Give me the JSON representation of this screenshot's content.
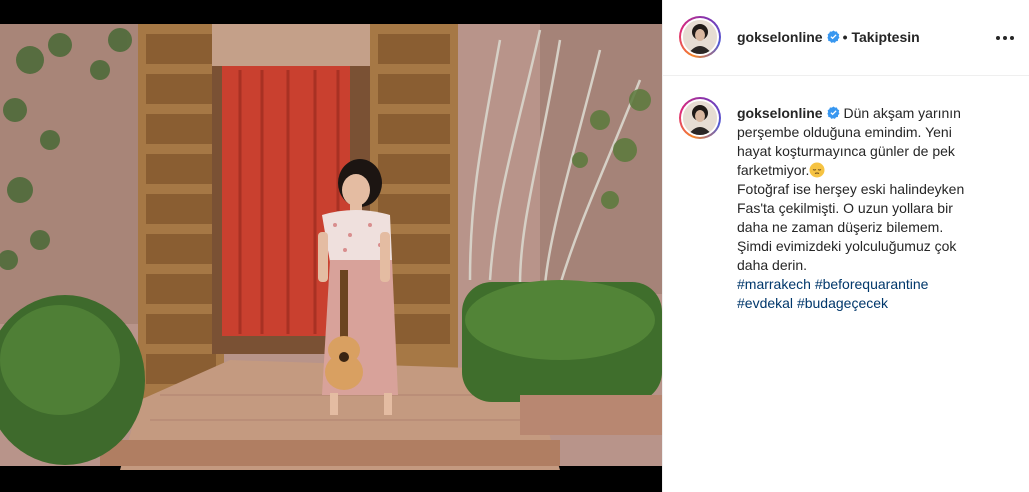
{
  "post": {
    "username": "gokselonline",
    "follow_status": "Takiptesin",
    "separator": "•",
    "more_icon": "more-horizontal-icon",
    "verified_icon": "verified-badge-icon",
    "photo_alt": "Woman with ukulele standing in front of carved wooden doors with a red curtain"
  },
  "caption": {
    "username": "gokselonline",
    "line1": "Dün akşam yarının",
    "line2": "perşembe olduğuna emindim. Yeni",
    "line3": "hayat koşturmayınca günler de pek",
    "line4": "farketmiyor.",
    "emoji": "😔",
    "line5": "Fotoğraf ise herşey eski halindeyken",
    "line6": "Fas'ta çekilmişti. O uzun yollara bir",
    "line7": "daha ne zaman düşeriz bilemem.",
    "line8": "Şimdi evimizdeki yolculuğumuz çok",
    "line9": "daha derin.",
    "hashtags": [
      "#marrakech",
      "#beforequarantine",
      "#evdekal",
      "#budageçecek"
    ]
  },
  "colors": {
    "link": "#00376b",
    "verified": "#3897f0",
    "border": "#efefef"
  }
}
